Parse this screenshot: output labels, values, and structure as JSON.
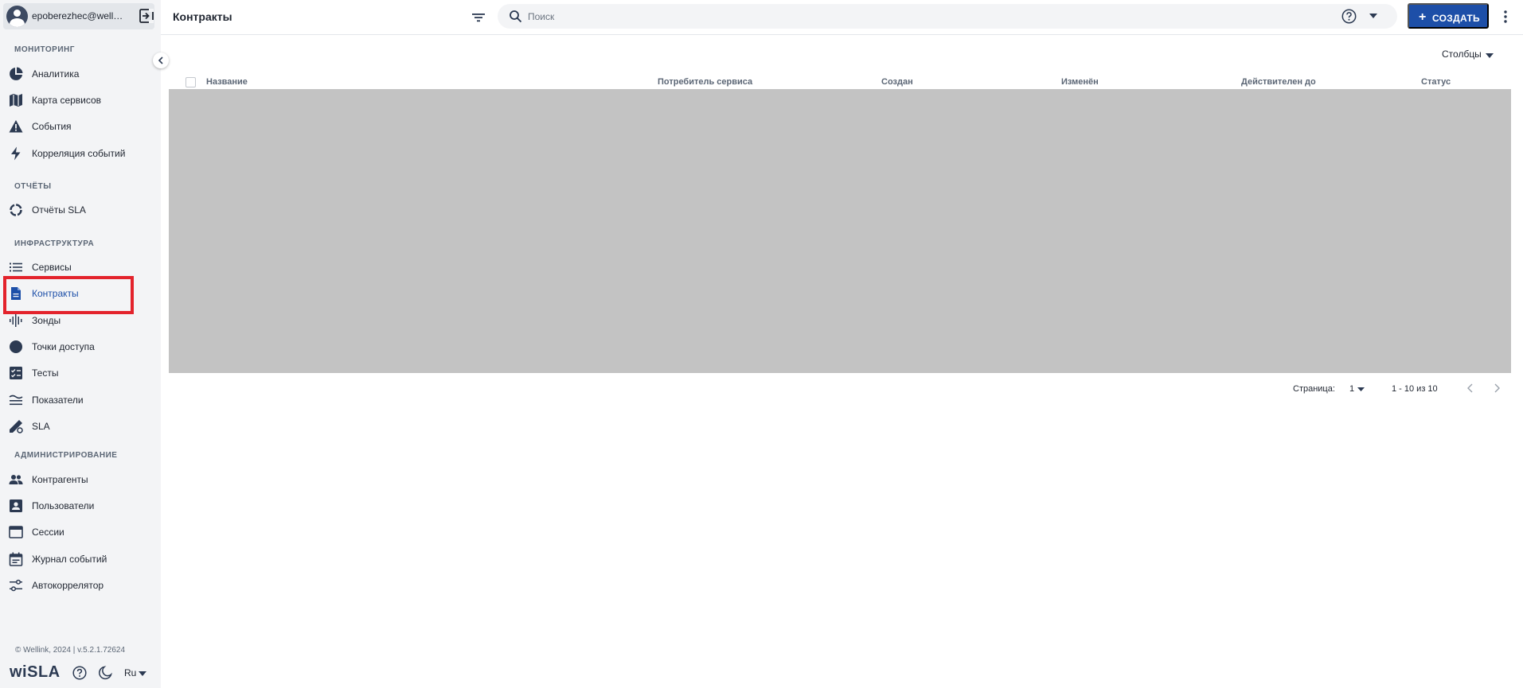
{
  "user": {
    "name": "epoberezhec@wellink.ru"
  },
  "sidebar": {
    "sections": [
      {
        "title": "МОНИТОРИНГ"
      },
      {
        "title": "ОТЧЁТЫ"
      },
      {
        "title": "ИНФРАСТРУКТУРА"
      },
      {
        "title": "АДМИНИСТРИРОВАНИЕ"
      }
    ],
    "items": [
      {
        "label": "Аналитика",
        "icon": "pie-chart-icon"
      },
      {
        "label": "Карта сервисов",
        "icon": "map-icon"
      },
      {
        "label": "События",
        "icon": "warning-icon"
      },
      {
        "label": "Корреляция событий",
        "icon": "bolt-icon"
      },
      {
        "label": "Отчёты SLA",
        "icon": "donut-icon"
      },
      {
        "label": "Сервисы",
        "icon": "list-icon"
      },
      {
        "label": "Контракты",
        "icon": "document-icon",
        "active": true
      },
      {
        "label": "Зонды",
        "icon": "probe-icon"
      },
      {
        "label": "Точки доступа",
        "icon": "circle-icon"
      },
      {
        "label": "Тесты",
        "icon": "checklist-icon"
      },
      {
        "label": "Показатели",
        "icon": "metrics-icon"
      },
      {
        "label": "SLA",
        "icon": "sla-icon"
      },
      {
        "label": "Контрагенты",
        "icon": "people-icon"
      },
      {
        "label": "Пользователи",
        "icon": "user-card-icon"
      },
      {
        "label": "Сессии",
        "icon": "window-icon"
      },
      {
        "label": "Журнал событий",
        "icon": "calendar-icon"
      },
      {
        "label": "Автокоррелятор",
        "icon": "sliders-icon"
      }
    ],
    "footer": {
      "copyright": "© Wellink, 2024 | v.5.2.1.72624",
      "brand": "wiSLA",
      "language": "Ru"
    }
  },
  "header": {
    "title": "Контракты",
    "search": {
      "placeholder": "Поиск",
      "value": ""
    },
    "create_label": "СОЗДАТЬ"
  },
  "table": {
    "columns_label": "Столбцы",
    "columns": [
      "Название",
      "Потребитель сервиса",
      "Создан",
      "Изменён",
      "Действителен до",
      "Статус"
    ]
  },
  "pagination": {
    "page_label": "Страница:",
    "page": "1",
    "range": "1 - 10 из 10"
  },
  "colors": {
    "accent": "#1d4fa8",
    "sidebar_bg": "#f3f4f6",
    "highlight": "#e3232c",
    "placeholder_block": "#c3c3c3"
  }
}
